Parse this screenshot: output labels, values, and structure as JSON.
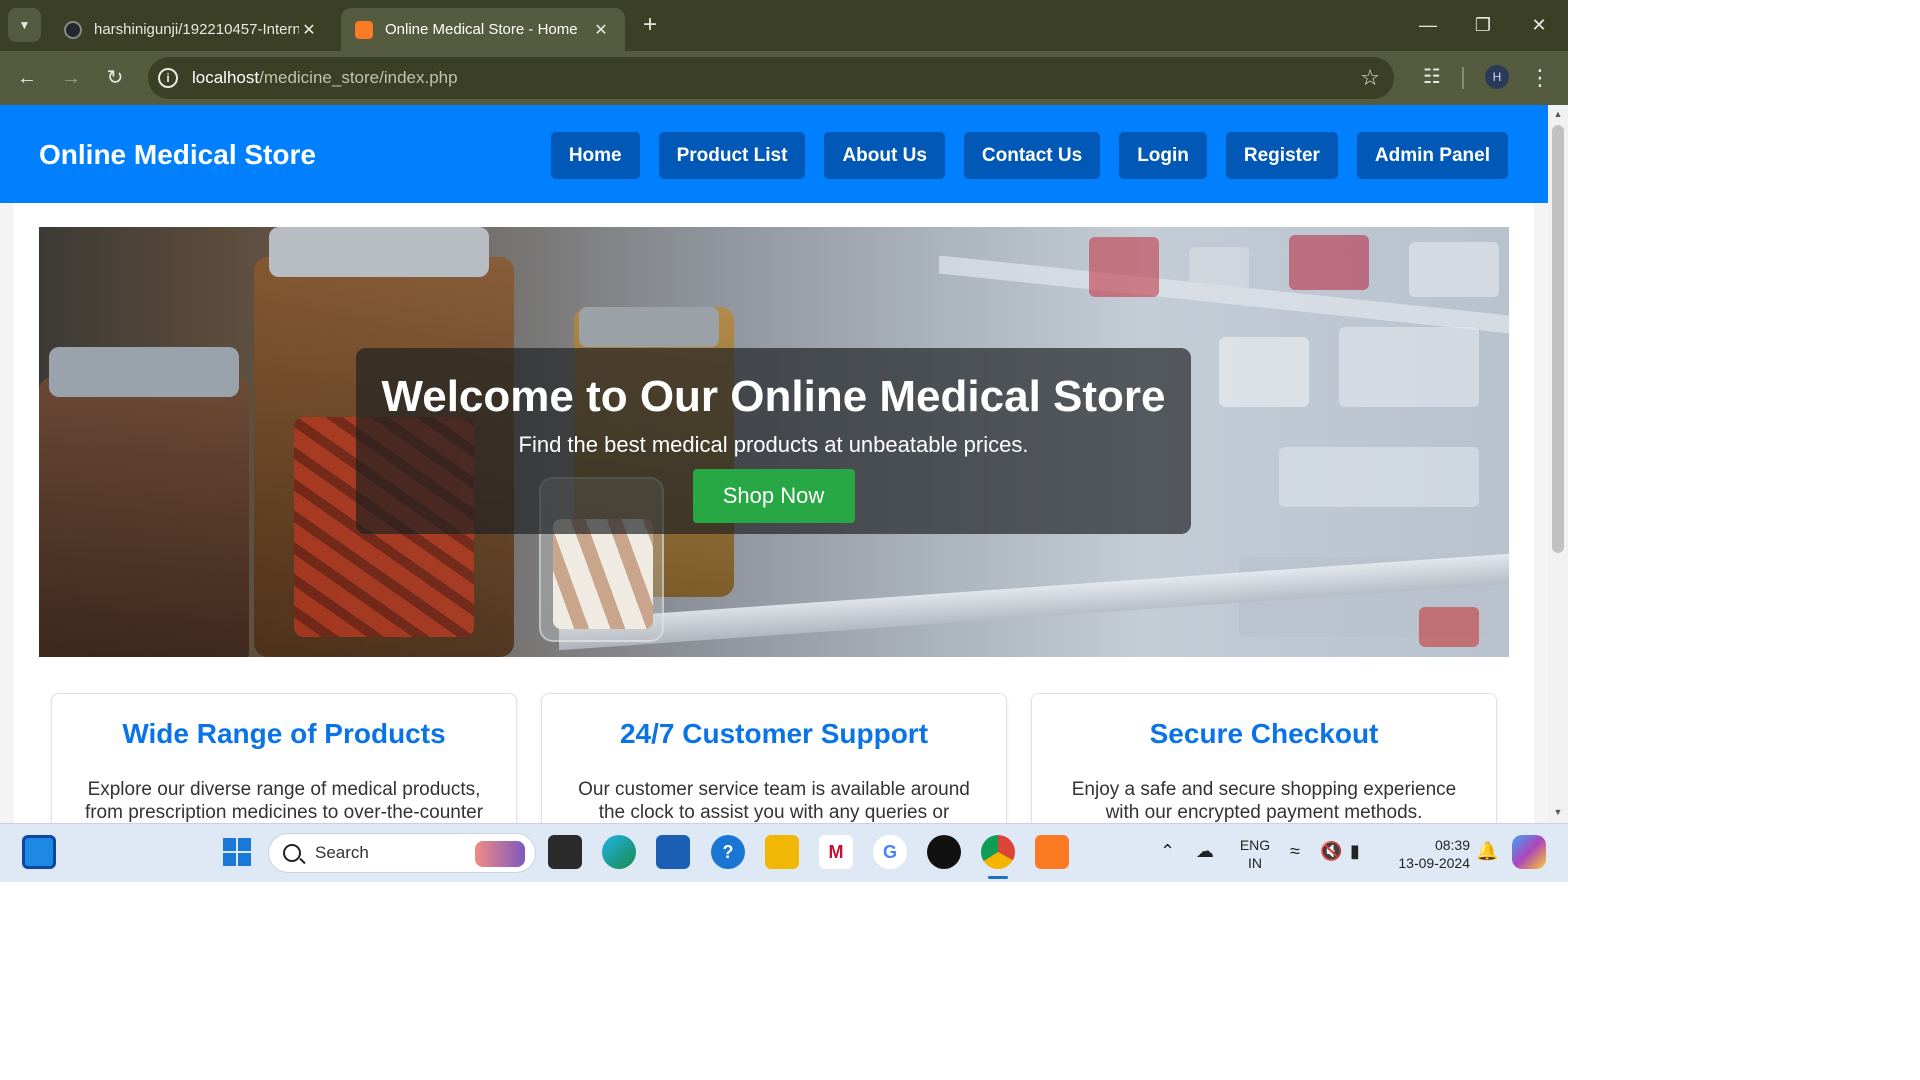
{
  "browser": {
    "tabs": [
      {
        "title": "harshinigunji/192210457-Intern",
        "active": false
      },
      {
        "title": "Online Medical Store - Home",
        "active": true
      }
    ],
    "url_host": "localhost",
    "url_path": "/medicine_store/index.php",
    "profile_initial": "H",
    "colors": {
      "frame": "#3a3f26",
      "toolbar": "#555b3f"
    }
  },
  "site": {
    "brand": "Online Medical Store",
    "nav": [
      "Home",
      "Product List",
      "About Us",
      "Contact Us",
      "Login",
      "Register",
      "Admin Panel"
    ],
    "colors": {
      "header": "#0080ff",
      "nav_button": "#0258b6",
      "cta": "#28a745",
      "feature_title": "#0a74e6"
    }
  },
  "hero": {
    "title": "Welcome to Our Online Medical Store",
    "subtitle": "Find the best medical products at unbeatable prices.",
    "cta": "Shop Now"
  },
  "features": [
    {
      "title": "Wide Range of Products",
      "desc": "Explore our diverse range of medical products, from prescription medicines to over-the-counter"
    },
    {
      "title": "24/7 Customer Support",
      "desc": "Our customer service team is available around the clock to assist you with any queries or"
    },
    {
      "title": "Secure Checkout",
      "desc": "Enjoy a safe and secure shopping experience with our encrypted payment methods."
    }
  ],
  "taskbar": {
    "search_placeholder": "Search",
    "lang_line1": "ENG",
    "lang_line2": "IN",
    "time": "08:39",
    "date": "13-09-2024"
  }
}
